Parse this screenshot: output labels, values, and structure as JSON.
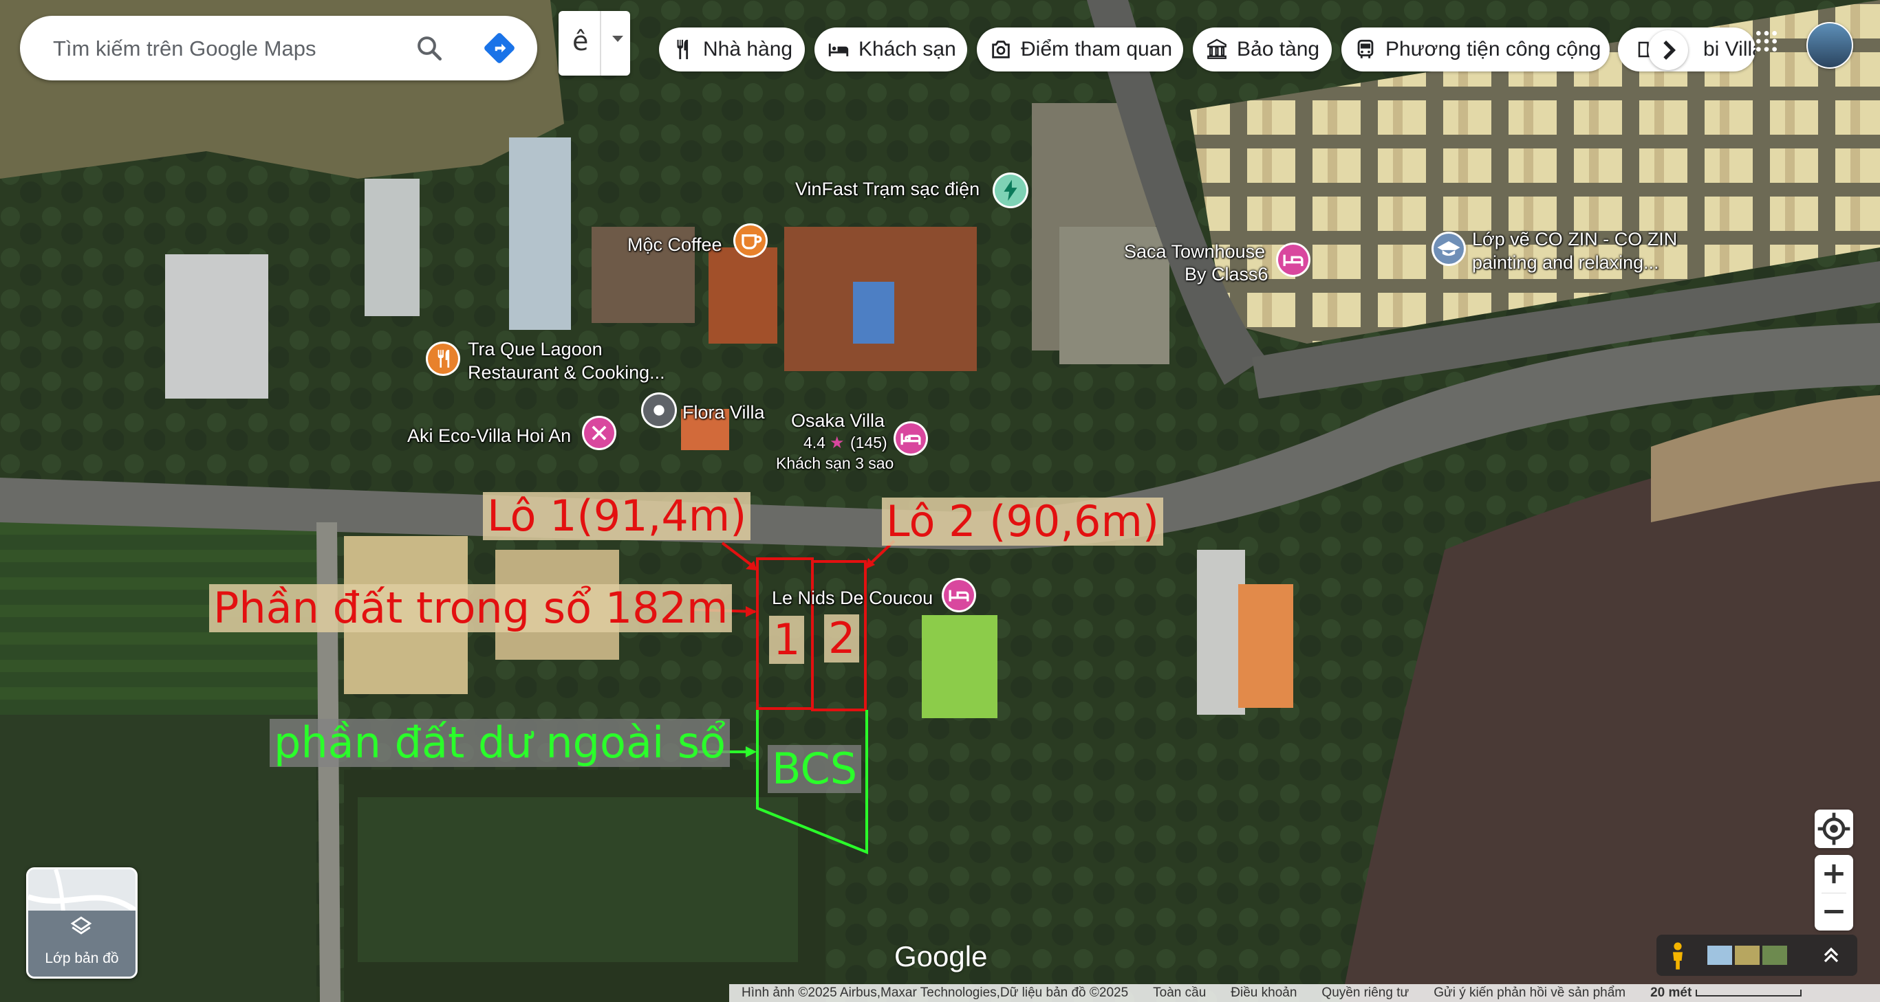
{
  "search": {
    "placeholder": "Tìm kiếm trên Google Maps"
  },
  "ime": {
    "char": "ê"
  },
  "chips": [
    {
      "label": "Nhà hàng",
      "icon": "fork-knife-icon"
    },
    {
      "label": "Khách sạn",
      "icon": "bed-icon"
    },
    {
      "label": "Điểm tham quan",
      "icon": "camera-icon"
    },
    {
      "label": "Bảo tàng",
      "icon": "museum-icon"
    },
    {
      "label": "Phương tiện công cộng",
      "icon": "bus-icon"
    }
  ],
  "overflow_chip": {
    "partial_label": "bi Villa"
  },
  "pois": {
    "vinfast": "VinFast Trạm sạc điện",
    "moc_coffee": "Mộc Coffee",
    "tra_que_1": "Tra Que Lagoon",
    "tra_que_2": "Restaurant & Cooking...",
    "flora": "Flora Villa",
    "aki": "Aki Eco-Villa Hoi An",
    "osaka": "Osaka Villa",
    "osaka_rating": "4.4",
    "osaka_reviews": "(145)",
    "osaka_type": "Khách sạn 3 sao",
    "saca_1": "Saca Townhouse",
    "saca_2": "By Class6",
    "lop_ve_1": "Lớp vẽ CO ZIN - CO ZIN",
    "lop_ve_2": "painting and relaxing...",
    "le_nids": "Le Nids De Coucou"
  },
  "annotations": {
    "lot1": "Lô 1(91,4m)",
    "lot2": "Lô 2 (90,6m)",
    "in_book": "Phần đất trong sổ 182m",
    "outside": "phần đất dư ngoài sổ",
    "num1": "1",
    "num2": "2",
    "bcs": "BCS"
  },
  "layer_button": {
    "label": "Lớp bản đồ"
  },
  "logo": "Google",
  "footer": {
    "imagery": "Hình ảnh ©2025 Airbus,Maxar Technologies,Dữ liệu bản đồ ©2025",
    "terms": "Toàn cầu",
    "terms2": "Điều khoản",
    "privacy": "Quyền riêng tư",
    "feedback": "Gửi ý kiến phản hồi về sản phẩm",
    "scale": "20 mét"
  },
  "colors": {
    "annotation_red": "#e31010",
    "annotation_green": "#2aff2a",
    "poi_pink": "#d9479e",
    "poi_orange": "#e8812b",
    "poi_gray": "#5f6368"
  }
}
